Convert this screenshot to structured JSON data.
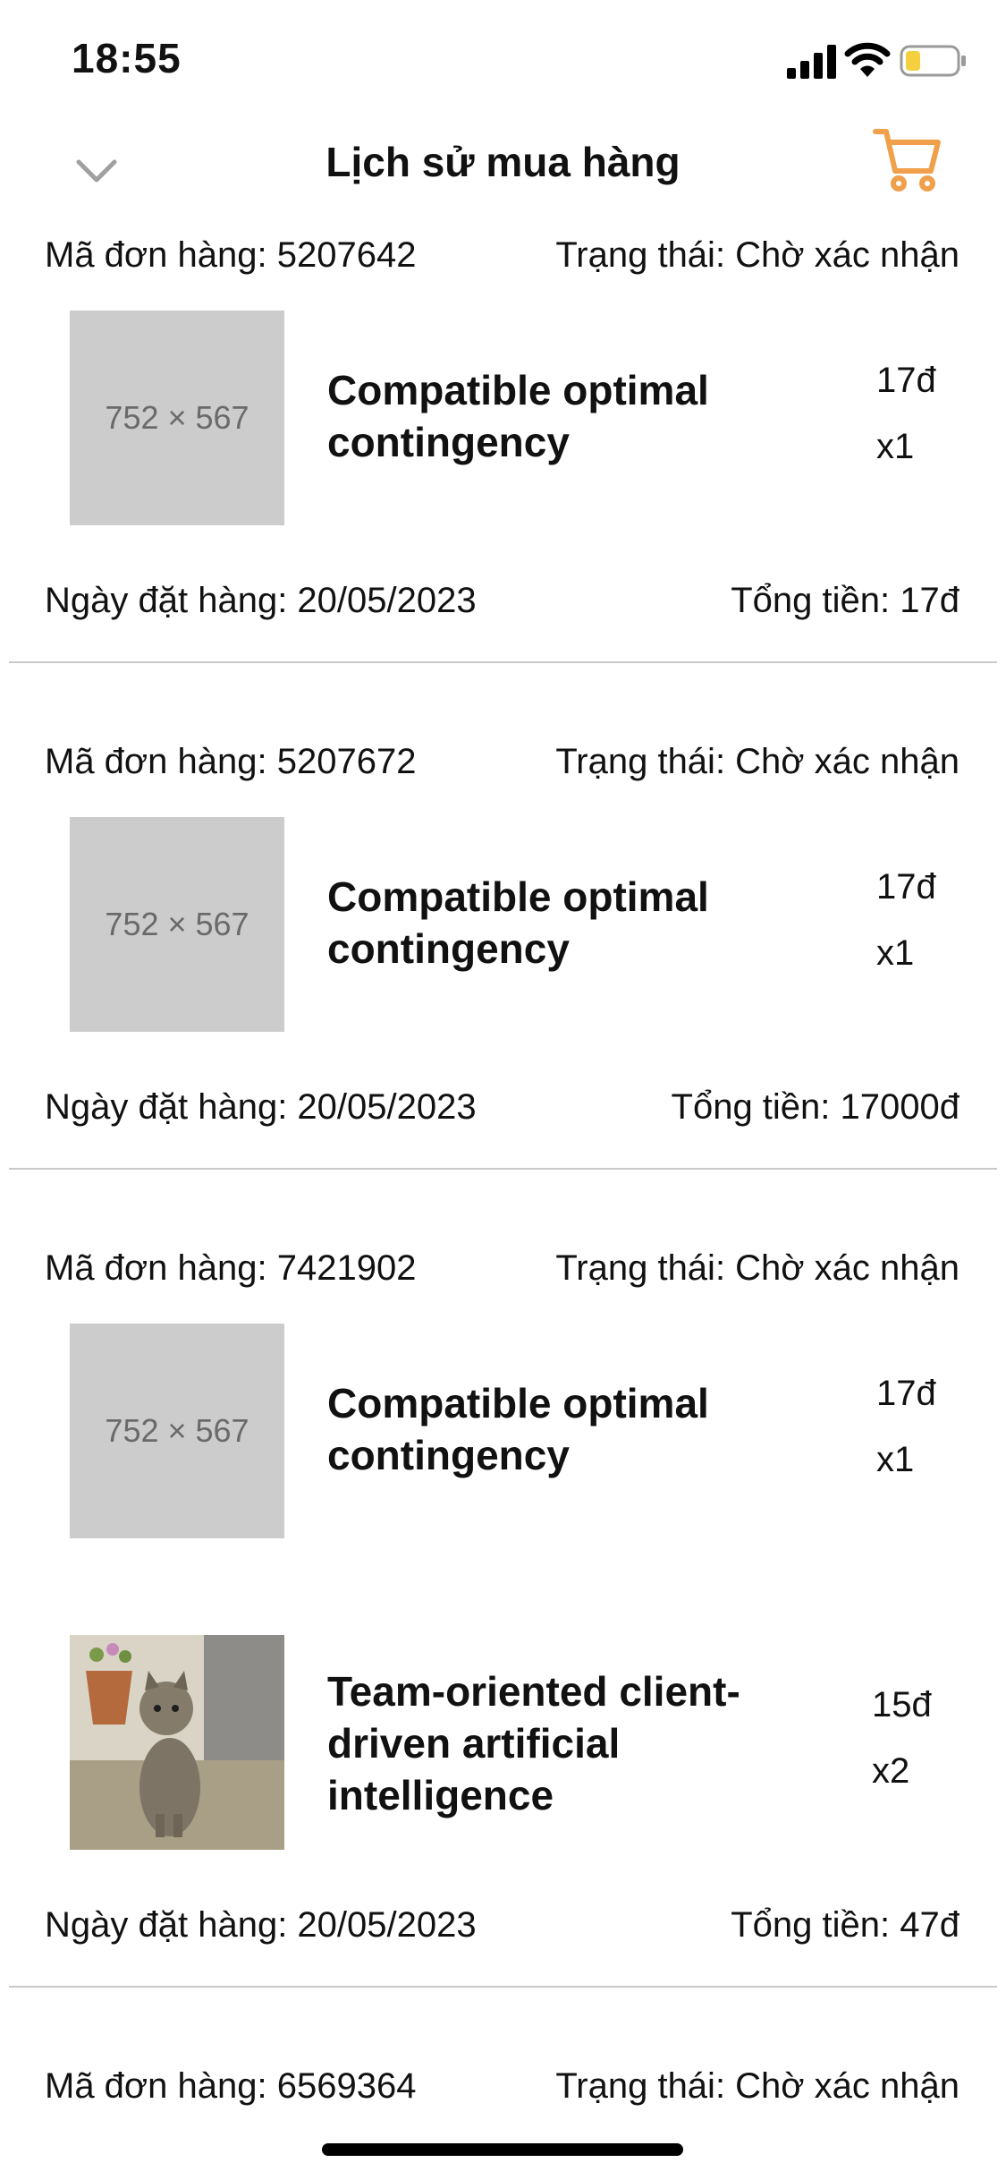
{
  "status_bar": {
    "time": "18:55"
  },
  "header": {
    "title": "Lịch sử mua hàng"
  },
  "colors": {
    "accent": "#F0A04B",
    "divider": "#C9C9C9",
    "placeholder": "#CCCCCC"
  },
  "orders": [
    {
      "code_label": "Mã đơn hàng: 5207642",
      "status_label": "Trạng thái: Chờ xác nhận",
      "items": [
        {
          "image_text": "752 × 567",
          "name": "Compatible optimal contingency",
          "price": "17đ",
          "qty": "x1"
        }
      ],
      "date_label": "Ngày đặt hàng: 20/05/2023",
      "total_label": "Tổng tiền: 17đ"
    },
    {
      "code_label": "Mã đơn hàng: 5207672",
      "status_label": "Trạng thái: Chờ xác nhận",
      "items": [
        {
          "image_text": "752 × 567",
          "name": "Compatible optimal contingency",
          "price": "17đ",
          "qty": "x1"
        }
      ],
      "date_label": "Ngày đặt hàng: 20/05/2023",
      "total_label": "Tổng tiền: 17000đ"
    },
    {
      "code_label": "Mã đơn hàng: 7421902",
      "status_label": "Trạng thái: Chờ xác nhận",
      "items": [
        {
          "image_text": "752 × 567",
          "name": "Compatible optimal contingency",
          "price": "17đ",
          "qty": "x1"
        },
        {
          "image_icon": "kitten-photo",
          "name": "Team-oriented client-driven artificial intelligence",
          "price": "15đ",
          "qty": "x2"
        }
      ],
      "date_label": "Ngày đặt hàng: 20/05/2023",
      "total_label": "Tổng tiền: 47đ"
    },
    {
      "code_label": "Mã đơn hàng: 6569364",
      "status_label": "Trạng thái: Chờ xác nhận"
    }
  ]
}
